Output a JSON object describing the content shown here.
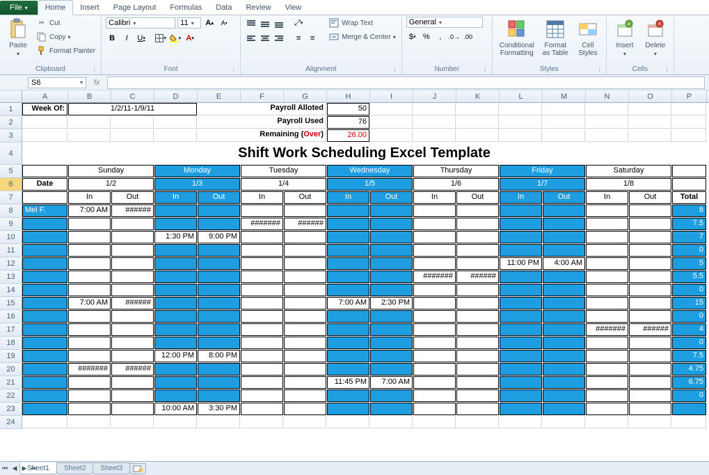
{
  "ribbon": {
    "tabs": [
      "File",
      "Home",
      "Insert",
      "Page Layout",
      "Formulas",
      "Data",
      "Review",
      "View"
    ],
    "active_tab": "Home",
    "clipboard": {
      "paste": "Paste",
      "cut": "Cut",
      "copy": "Copy",
      "format_painter": "Format Painter",
      "group": "Clipboard"
    },
    "font": {
      "name": "Calibri",
      "size": "11",
      "group": "Font"
    },
    "alignment": {
      "wrap": "Wrap Text",
      "merge": "Merge & Center",
      "group": "Alignment"
    },
    "number": {
      "format": "General",
      "group": "Number"
    },
    "styles": {
      "cond": "Conditional\nFormatting",
      "table": "Format\nas Table",
      "cell": "Cell\nStyles",
      "group": "Styles"
    },
    "cells": {
      "insert": "Insert",
      "delete": "Delete",
      "group": "Cells"
    }
  },
  "name_box": "S6",
  "formula": "",
  "columns": [
    "A",
    "B",
    "C",
    "D",
    "E",
    "F",
    "G",
    "H",
    "I",
    "J",
    "K",
    "L",
    "M",
    "N",
    "O",
    "P"
  ],
  "row_numbers": [
    1,
    2,
    3,
    4,
    5,
    6,
    7,
    8,
    9,
    10,
    11,
    12,
    13,
    14,
    15,
    16,
    17,
    18,
    19,
    20,
    21,
    22,
    23,
    24
  ],
  "sheet": {
    "week_of_label": "Week Of:",
    "week_of_value": "1/2/11-1/9/11",
    "payroll_alloted_label": "Payroll Alloted",
    "payroll_alloted_value": "50",
    "payroll_used_label": "Payroll Used",
    "payroll_used_value": "76",
    "remaining_label": "Remaining (",
    "remaining_over": "Over",
    "remaining_close": ")",
    "remaining_value": "26.00",
    "title": "Shift Work Scheduling Excel Template",
    "days": [
      "Sunday",
      "Monday",
      "Tuesday",
      "Wednesday",
      "Thursday",
      "Friday",
      "Saturday"
    ],
    "date_label": "Date",
    "dates": [
      "1/2",
      "1/3",
      "1/4",
      "1/5",
      "1/6",
      "1/7",
      "1/8"
    ],
    "in": "In",
    "out": "Out",
    "total": "Total",
    "rows": [
      {
        "name": "Mel F.",
        "cells": [
          "7:00 AM",
          "######",
          "",
          "",
          "",
          "",
          "",
          "",
          "",
          "",
          "",
          "",
          "",
          ""
        ],
        "total": "8"
      },
      {
        "name": "",
        "cells": [
          "",
          "",
          "",
          "",
          "#######",
          "######",
          "",
          "",
          "",
          "",
          "",
          "",
          "",
          ""
        ],
        "total": "7.5"
      },
      {
        "name": "",
        "cells": [
          "",
          "",
          "1:30 PM",
          "9:00 PM",
          "",
          "",
          "",
          "",
          "",
          "",
          "",
          "",
          "",
          ""
        ],
        "total": "7"
      },
      {
        "name": "",
        "cells": [
          "",
          "",
          "",
          "",
          "",
          "",
          "",
          "",
          "",
          "",
          "",
          "",
          "",
          ""
        ],
        "total": "0"
      },
      {
        "name": "",
        "cells": [
          "",
          "",
          "",
          "",
          "",
          "",
          "",
          "",
          "",
          "",
          "11:00 PM",
          "4:00 AM",
          "",
          ""
        ],
        "total": "5"
      },
      {
        "name": "",
        "cells": [
          "",
          "",
          "",
          "",
          "",
          "",
          "",
          "",
          "#######",
          "######",
          "",
          "",
          "",
          ""
        ],
        "total": "5.5"
      },
      {
        "name": "",
        "cells": [
          "",
          "",
          "",
          "",
          "",
          "",
          "",
          "",
          "",
          "",
          "",
          "",
          "",
          ""
        ],
        "total": "0"
      },
      {
        "name": "",
        "cells": [
          "7:00 AM",
          "######",
          "",
          "",
          "",
          "",
          "7:00 AM",
          "2:30 PM",
          "",
          "",
          "",
          "",
          "",
          ""
        ],
        "total": "15"
      },
      {
        "name": "",
        "cells": [
          "",
          "",
          "",
          "",
          "",
          "",
          "",
          "",
          "",
          "",
          "",
          "",
          "",
          ""
        ],
        "total": "0"
      },
      {
        "name": "",
        "cells": [
          "",
          "",
          "",
          "",
          "",
          "",
          "",
          "",
          "",
          "",
          "",
          "",
          "#######",
          "######"
        ],
        "total": "4"
      },
      {
        "name": "",
        "cells": [
          "",
          "",
          "",
          "",
          "",
          "",
          "",
          "",
          "",
          "",
          "",
          "",
          "",
          ""
        ],
        "total": "0"
      },
      {
        "name": "",
        "cells": [
          "",
          "",
          "12:00 PM",
          "8:00 PM",
          "",
          "",
          "",
          "",
          "",
          "",
          "",
          "",
          "",
          ""
        ],
        "total": "7.5"
      },
      {
        "name": "",
        "cells": [
          "#######",
          "######",
          "",
          "",
          "",
          "",
          "",
          "",
          "",
          "",
          "",
          "",
          "",
          ""
        ],
        "total": "4.75"
      },
      {
        "name": "",
        "cells": [
          "",
          "",
          "",
          "",
          "",
          "",
          "11:45 PM",
          "7:00 AM",
          "",
          "",
          "",
          "",
          "",
          ""
        ],
        "total": "6.75"
      },
      {
        "name": "",
        "cells": [
          "",
          "",
          "",
          "",
          "",
          "",
          "",
          "",
          "",
          "",
          "",
          "",
          "",
          ""
        ],
        "total": "0"
      },
      {
        "name": "",
        "cells": [
          "",
          "",
          "10:00 AM",
          "3:30 PM",
          "",
          "",
          "",
          "",
          "",
          "",
          "",
          "",
          "",
          ""
        ],
        "total": ""
      }
    ]
  },
  "sheet_tabs": [
    "Sheet1",
    "Sheet2",
    "Sheet3"
  ],
  "active_sheet": "Sheet1",
  "chart_data": {
    "type": "table",
    "title": "Shift Work Scheduling Excel Template",
    "week": "1/2/11-1/9/11",
    "payroll_alloted": 50,
    "payroll_used": 76,
    "remaining_over": 26.0,
    "days": [
      "Sunday",
      "Monday",
      "Tuesday",
      "Wednesday",
      "Thursday",
      "Friday",
      "Saturday"
    ],
    "dates": [
      "1/2",
      "1/3",
      "1/4",
      "1/5",
      "1/6",
      "1/7",
      "1/8"
    ],
    "totals_by_row": [
      8,
      7.5,
      7,
      0,
      5,
      5.5,
      0,
      15,
      0,
      4,
      0,
      7.5,
      4.75,
      6.75,
      0,
      null
    ]
  }
}
